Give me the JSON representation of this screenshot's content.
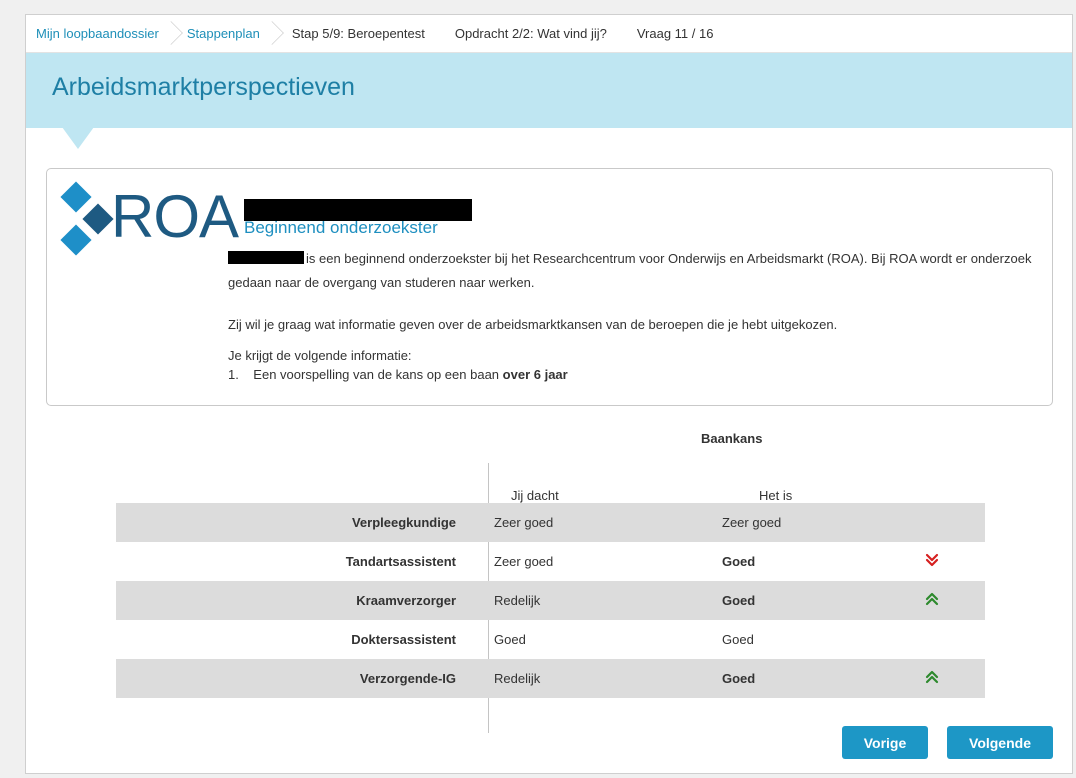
{
  "breadcrumb": {
    "items": [
      {
        "label": "Mijn loopbaandossier"
      },
      {
        "label": "Stappenplan"
      },
      {
        "label": "Stap 5/9: Beroepentest"
      },
      {
        "label": "Opdracht 2/2: Wat vind jij?"
      },
      {
        "label": "Vraag 11 / 16"
      }
    ]
  },
  "page": {
    "title": "Arbeidsmarktperspectieven"
  },
  "card": {
    "logo_text": "ROA",
    "role": "Beginnend onderzoekster",
    "p1": "is een beginnend onderzoekster bij het Researchcentrum voor Onderwijs en Arbeidsmarkt (ROA). Bij ROA wordt er onderzoek gedaan naar de overgang van studeren naar werken.",
    "p2": "Zij wil je graag wat informatie geven over de arbeidsmarktkansen van de beroepen die je hebt uitgekozen.",
    "p3": "Je krijgt de volgende informatie:",
    "list_item_number": "1.",
    "list_item_text": "Een voorspelling van de kans op een baan",
    "list_item_bold": "over 6 jaar"
  },
  "table": {
    "group_header": "Baankans",
    "col_thought": "Jij dacht",
    "col_actual": "Het is",
    "rows": [
      {
        "occupation": "Verpleegkundige",
        "thought": "Zeer goed",
        "actual": "Zeer goed",
        "arrow": ""
      },
      {
        "occupation": "Tandartsassistent",
        "thought": "Zeer goed",
        "actual": "Goed",
        "arrow": "down"
      },
      {
        "occupation": "Kraamverzorger",
        "thought": "Redelijk",
        "actual": "Goed",
        "arrow": "up"
      },
      {
        "occupation": "Doktersassistent",
        "thought": "Goed",
        "actual": "Goed",
        "arrow": ""
      },
      {
        "occupation": "Verzorgende-IG",
        "thought": "Redelijk",
        "actual": "Goed",
        "arrow": "up"
      }
    ]
  },
  "buttons": {
    "prev": "Vorige",
    "next": "Volgende"
  },
  "colors": {
    "accent": "#1d97c6",
    "band": "#bfe6f2",
    "down": "#d62020",
    "up": "#2d8a2d"
  }
}
